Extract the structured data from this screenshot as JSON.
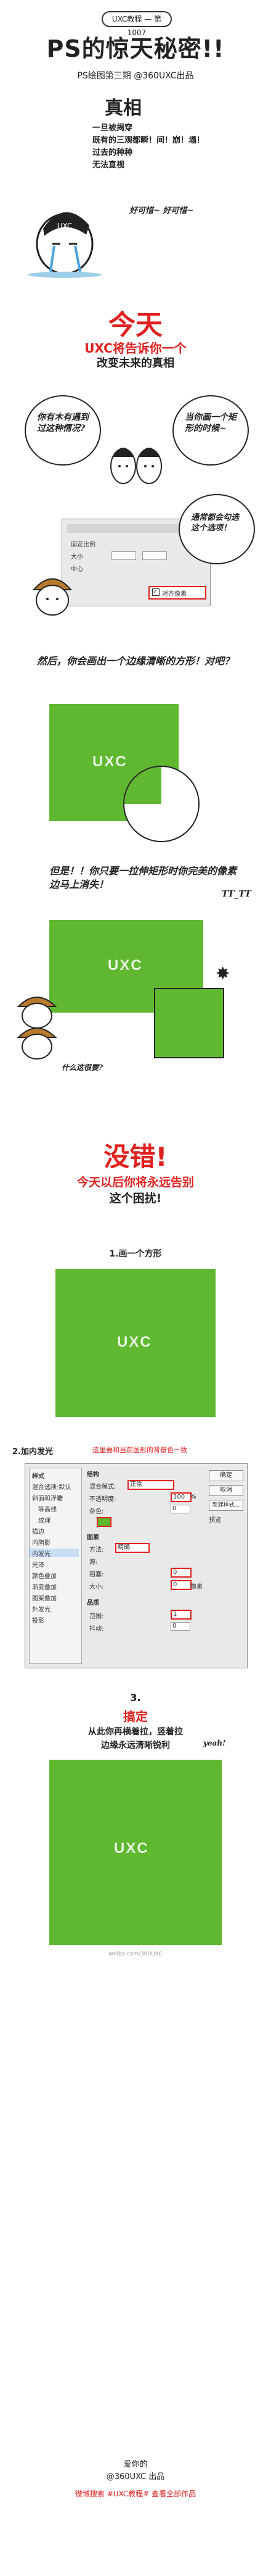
{
  "header": {
    "badge": "UXC教程 — 第1007",
    "title": "PS的惊天秘密!!",
    "credit": "PS绘图第三期 @360UXC出品"
  },
  "truth": {
    "title": "真相",
    "lines": [
      "一旦被揭穿",
      "既有的三观都瞬！间！崩！塌！",
      "过去的种种",
      "无法直视"
    ],
    "caption": "好可惜~ 好可惜~"
  },
  "today": {
    "title": "今天",
    "line1": "UXC将告诉你一个",
    "line2": "改变未来的真相"
  },
  "bubbles": {
    "left": "你有木有遇到过这种情况?",
    "right": "当你画一个矩形的时候~"
  },
  "ps_dialog": {
    "callout": "通常都会勾选这个选项！",
    "checkbox_label": "对齐像素",
    "rows": [
      "固定比例",
      "大小",
      "中心",
      "对齐像素"
    ]
  },
  "mid": {
    "note1": "然后，你会画出一个边缘清晰的方形！对吧？",
    "logo": "UXC",
    "note2": "但是！！你只要一拉伸矩形时你完美的像素边马上消失！",
    "cry": "TT_TT",
    "small": "什么这很要?"
  },
  "wrong": {
    "title": "没错!",
    "line1": "今天以后你将永远告别",
    "line2": "这个困扰!"
  },
  "steps": {
    "step1": "1.画一个方形",
    "step1_logo": "UXC",
    "step2_title": "2.加内发光",
    "step2_note": "这里要和当前图形的背景色一致",
    "step3_num": "3.",
    "step3_title": "搞定",
    "step3_line1": "从此你再横着拉，竖着拉",
    "step3_line2": "边缘永远清晰锐利",
    "step3_yeah": "yeah!",
    "step3_logo": "UXC",
    "watermark": "weibo.com/360UXC"
  },
  "layer_style": {
    "panel_title": "样式",
    "left_items": [
      "样式",
      "混合选项:默认",
      "斜面和浮雕",
      "等高线",
      "纹理",
      "描边",
      "内阴影",
      "内发光",
      "光泽",
      "颜色叠加",
      "渐变叠加",
      "图案叠加",
      "外发光",
      "投影"
    ],
    "section1": "结构",
    "blend_mode_label": "混合模式:",
    "blend_mode": "正常",
    "opacity_label": "不透明度:",
    "opacity": "100",
    "noise_label": "杂色:",
    "noise": "0",
    "section2": "图素",
    "method_label": "方法:",
    "method": "精确",
    "source_label": "源:",
    "choke_label": "阻塞:",
    "choke": "0",
    "size_label": "大小:",
    "size": "0",
    "section3": "品质",
    "range_label": "范围:",
    "range": "1",
    "jitter_label": "抖动:",
    "jitter": "0",
    "percent": "%",
    "px": "像素",
    "buttons": [
      "确定",
      "取消",
      "新建样式...",
      "预览"
    ]
  },
  "footer": {
    "love": "爱你的",
    "signature": "@360UXC 出品",
    "line": "微博搜索 #UXC教程# 查看全部作品"
  },
  "colors": {
    "green": "#5fb82f",
    "red": "#e0201f"
  }
}
